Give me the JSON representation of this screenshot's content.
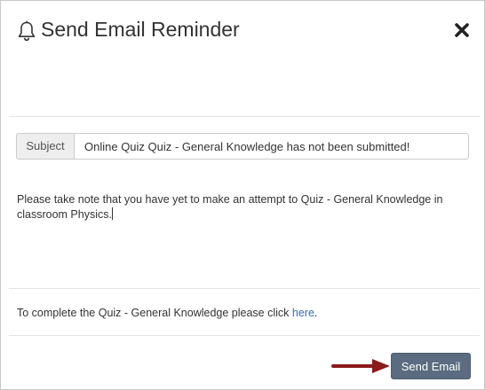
{
  "modal": {
    "title": "Send Email Reminder",
    "bell_icon": "bell-icon",
    "close_icon": "close-icon"
  },
  "subject": {
    "label": "Subject",
    "value": "Online Quiz Quiz - General Knowledge has not been submitted!"
  },
  "message": {
    "body": "Please take note that you have yet to make an attempt to Quiz - General Knowledge in classroom Physics."
  },
  "footer": {
    "text_prefix": "To complete the Quiz - General Knowledge please click ",
    "link_text": "here",
    "text_suffix": "."
  },
  "actions": {
    "send_label": "Send Email",
    "annotation_arrow_color": "#8b1a1a",
    "send_button_color": "#5b6c80"
  }
}
